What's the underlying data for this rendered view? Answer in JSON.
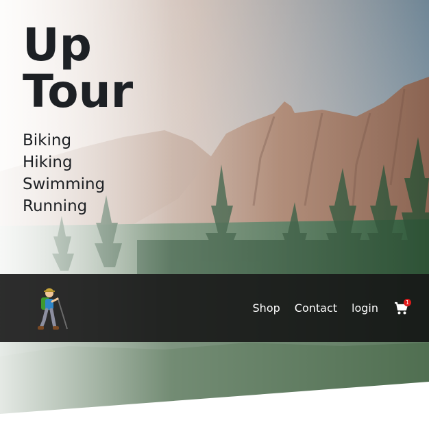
{
  "hero": {
    "brand_line1": "Up",
    "brand_line2": "Tour",
    "activities": [
      "Biking",
      "Hiking",
      "Swimming",
      "Running"
    ]
  },
  "navbar": {
    "links": [
      "Shop",
      "Contact",
      "login"
    ],
    "cart_count": "1",
    "logo_icon": "hiker-icon",
    "cart_icon": "shopping-cart-icon"
  },
  "colors": {
    "heading_text": "#1d2024",
    "navbar_bg": "#161616",
    "nav_text": "#ffffff",
    "badge": "#e01b1b"
  }
}
